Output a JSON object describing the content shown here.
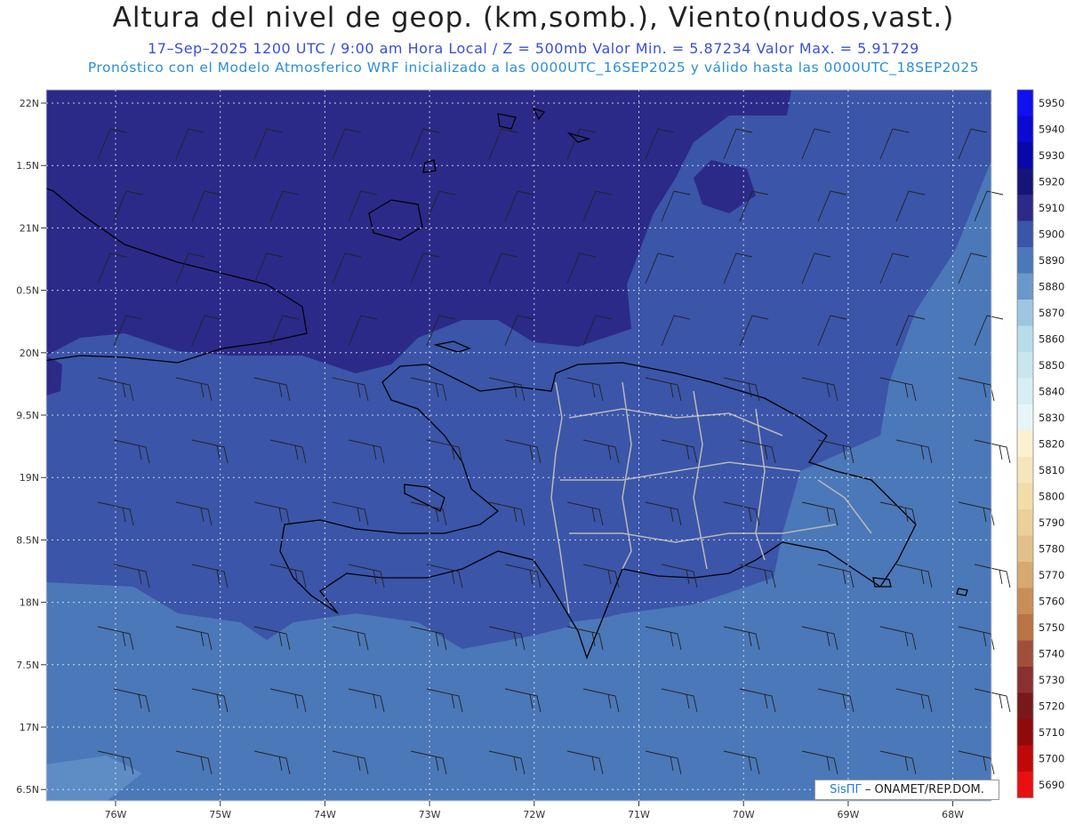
{
  "header": {
    "title": "Altura del nivel de geop. (km,somb.), Viento(nudos,vast.)",
    "line1": "17–Sep–2025  1200 UTC / 9:00 am Hora Local / Z = 500mb     Valor Min. = 5.87234  Valor Max. = 5.91729",
    "line2": "Pronóstico con el Modelo Atmosferico WRF inicializado a las 0000UTC_16SEP2025 y válido hasta las  0000UTC_18SEP2025"
  },
  "axes": {
    "lat_labels": [
      "22N",
      "1.5N",
      "21N",
      "0.5N",
      "20N",
      "9.5N",
      "19N",
      "8.5N",
      "18N",
      "7.5N",
      "17N",
      "6.5N"
    ],
    "lon_labels": [
      "76W",
      "75W",
      "74W",
      "73W",
      "72W",
      "71W",
      "70W",
      "69W",
      "68W"
    ]
  },
  "colorbar": {
    "levels": [
      "5950",
      "5940",
      "5930",
      "5920",
      "5910",
      "5900",
      "5890",
      "5880",
      "5870",
      "5860",
      "5850",
      "5840",
      "5830",
      "5820",
      "5810",
      "5800",
      "5790",
      "5780",
      "5770",
      "5760",
      "5750",
      "5740",
      "5730",
      "5720",
      "5710",
      "5700",
      "5690"
    ],
    "colors": [
      "#1010f0",
      "#0a0ad0",
      "#0808a8",
      "#161478",
      "#2b2a88",
      "#3b55a8",
      "#4b78b8",
      "#6a98c8",
      "#9fc6e0",
      "#b8dcea",
      "#c9e6ef",
      "#d6eef4",
      "#e6f6f8",
      "#fbf0cf",
      "#f6e6bc",
      "#f1dcaa",
      "#ebd09a",
      "#e3c08a",
      "#d8a86e",
      "#c88e56",
      "#b87444",
      "#a0503a",
      "#8a3030",
      "#781818",
      "#900a0a",
      "#c00808",
      "#e81010"
    ]
  },
  "credit": {
    "logo": "SisПΓ",
    "text": " – ONAMET/REP.DOM."
  },
  "colors": {
    "zone_5910": "#2b2a88",
    "zone_5900": "#3b55a8",
    "zone_5890": "#4b78b8",
    "zone_5880": "#6a98c8",
    "coast": "#000000",
    "borders": "#b8b8b8"
  }
}
